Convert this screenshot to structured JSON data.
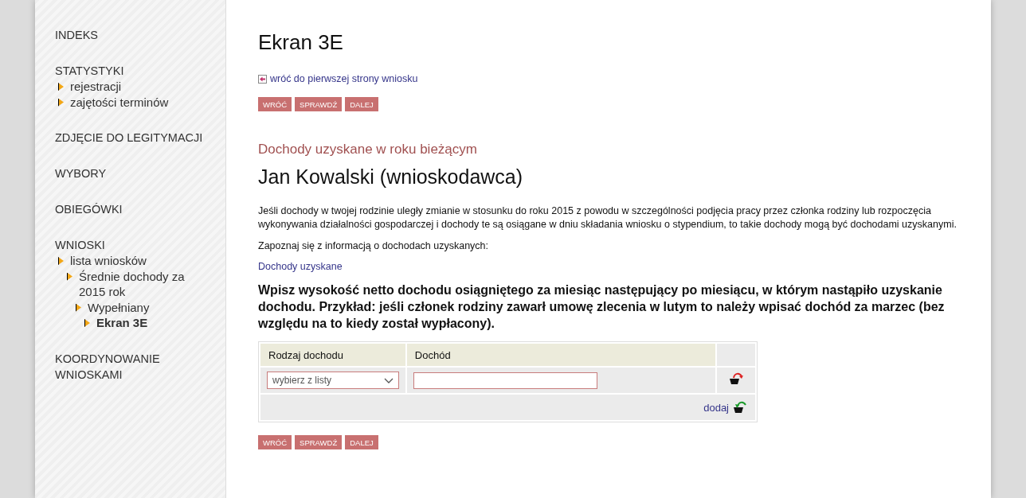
{
  "sidebar": {
    "sections": [
      {
        "title": "INDEKS"
      },
      {
        "title": "STATYSTYKI",
        "items": [
          {
            "label": "rejestracji",
            "selected": false
          },
          {
            "label": "zajętości terminów",
            "selected": false
          }
        ]
      },
      {
        "title": "ZDJĘCIE DO LEGITYMACJI"
      },
      {
        "title": "WYBORY"
      },
      {
        "title": "OBIEGÓWKI"
      },
      {
        "title": "WNIOSKI",
        "items": [
          {
            "label": "lista wniosków",
            "selected": false,
            "children": [
              {
                "label": "Średnie dochody za 2015 rok",
                "selected": false,
                "children": [
                  {
                    "label": "Wypełniany",
                    "selected": false,
                    "children": [
                      {
                        "label": "Ekran 3E",
                        "selected": true
                      }
                    ]
                  }
                ]
              }
            ]
          }
        ]
      },
      {
        "title": "KOORDYNOWANIE WNIOSKAMI"
      }
    ]
  },
  "main": {
    "title": "Ekran 3E",
    "back_link": "wróć do pierwszej strony wniosku",
    "buttons_top": [
      "WRÓĆ",
      "SPRAWDŹ",
      "DALEJ"
    ],
    "section_heading": "Dochody uzyskane w roku bieżącym",
    "person": "Jan Kowalski (wnioskodawca)",
    "paragraphs": [
      "Jeśli dochody w twojej rodzinie uległy zmianie w stosunku do roku 2015 z powodu w szczególności podjęcia pracy przez członka rodziny lub rozpoczęcia wykonywania działalności gospodarczej i dochody te są osiągane w dniu składania wniosku o stypendium, to takie dochody mogą być dochodami uzyskanymi.",
      "Zapoznaj się z informacją o dochodach uzyskanych:"
    ],
    "info_link": "Dochody uzyskane",
    "instruction": "Wpisz wysokość netto dochodu osiągniętego za miesiąc następujący po miesiącu, w którym nastąpiło uzyskanie dochodu. Przykład: jeśli członek rodziny zawarł umowę zlecenia w lutym to należy wpisać dochód za marzec (bez względu na to kiedy został wypłacony).",
    "table": {
      "columns": [
        "Rodzaj dochodu",
        "Dochód"
      ],
      "rows": [
        {
          "type_select": {
            "placeholder": "wybierz z listy"
          }
        }
      ],
      "add_link": "dodaj"
    },
    "buttons_bottom": [
      "WRÓĆ",
      "SPRAWDŹ",
      "DALEJ"
    ]
  }
}
